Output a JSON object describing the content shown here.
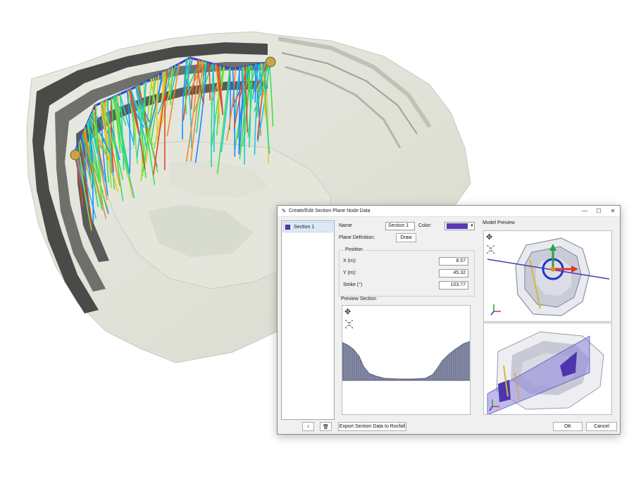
{
  "dialog": {
    "title": "Create/Edit Section Plane Node Data",
    "window_buttons": {
      "minimize": "—",
      "maximize": "☐",
      "close": "✕"
    },
    "sections": [
      {
        "label": "Section 1",
        "color": "#5b39b4"
      }
    ],
    "name_label": "Name",
    "name_value": "Section 1",
    "color_label": "Color:",
    "color_value": "#5b39b4",
    "plane_definition_label": "Plane Definition:",
    "draw_button": "Draw",
    "position": {
      "title": "Position",
      "x_label": "X (m):",
      "x_value": "8.57",
      "y_label": "Y (m):",
      "y_value": "45.32",
      "strike_label": "Strike (°)",
      "strike_value": "103.77"
    },
    "preview_section_title": "Preview Section",
    "model_preview_title": "Model Preview",
    "add_button_icon": "add-section-icon",
    "delete_button_icon": "trash-icon",
    "export_button": "Export Section Data to Rocfall",
    "ok_button": "OK",
    "cancel_button": "Cancel"
  }
}
